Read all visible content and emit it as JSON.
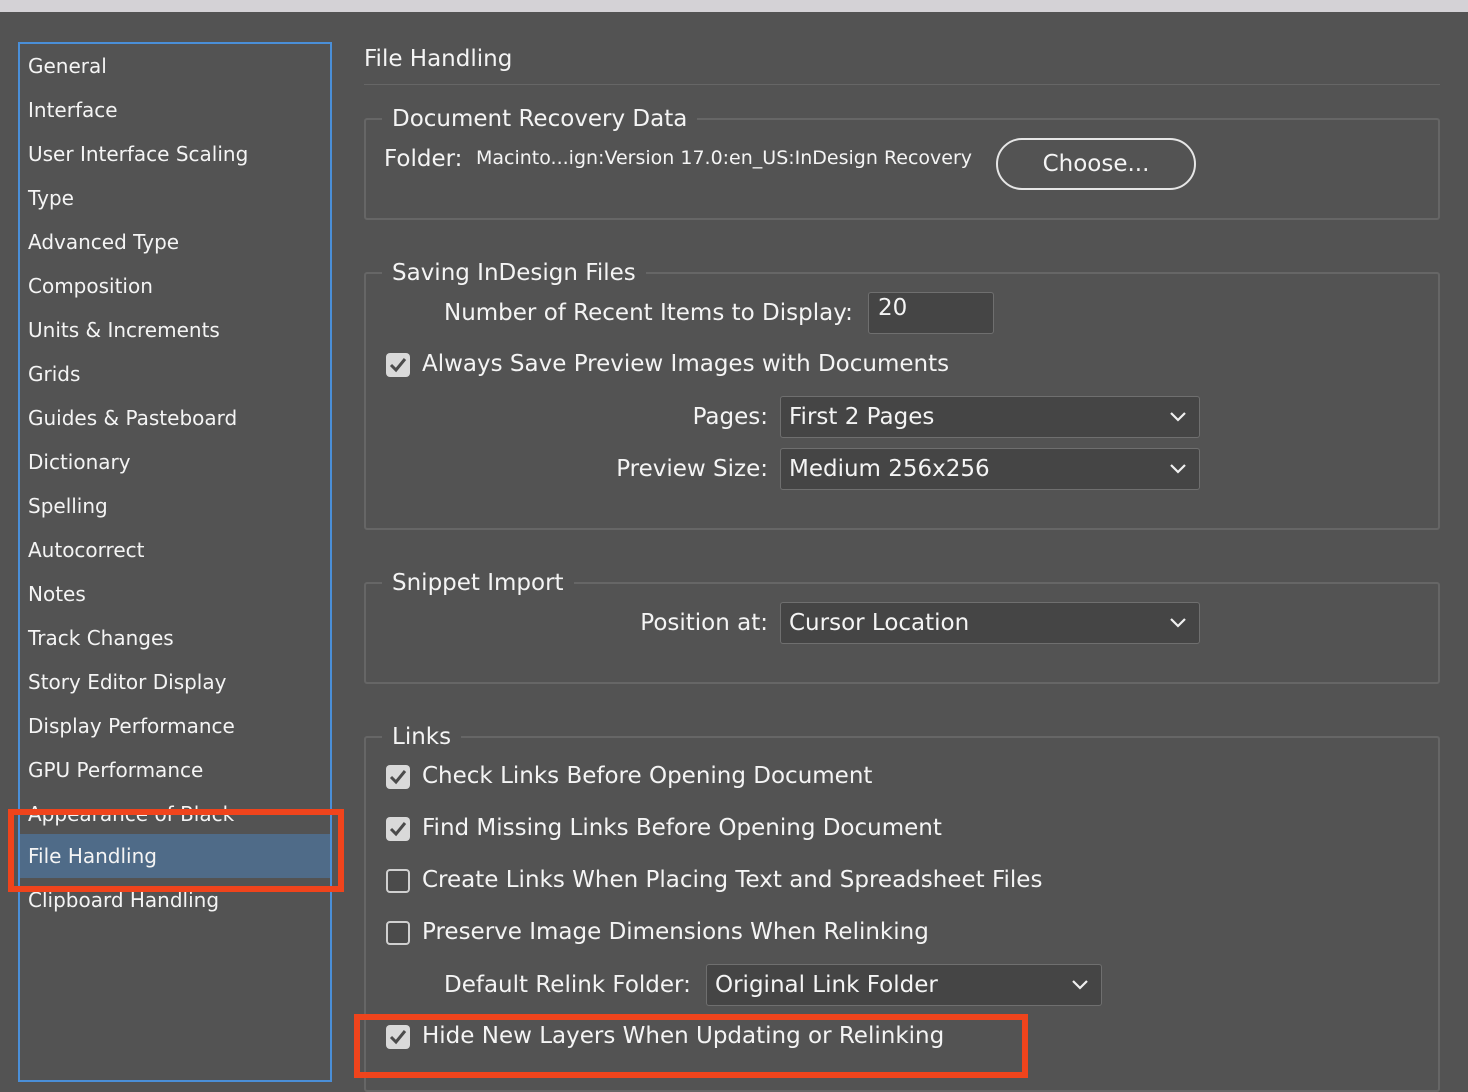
{
  "sidebar": {
    "items": [
      {
        "label": "General"
      },
      {
        "label": "Interface"
      },
      {
        "label": "User Interface Scaling"
      },
      {
        "label": "Type"
      },
      {
        "label": "Advanced Type"
      },
      {
        "label": "Composition"
      },
      {
        "label": "Units & Increments"
      },
      {
        "label": "Grids"
      },
      {
        "label": "Guides & Pasteboard"
      },
      {
        "label": "Dictionary"
      },
      {
        "label": "Spelling"
      },
      {
        "label": "Autocorrect"
      },
      {
        "label": "Notes"
      },
      {
        "label": "Track Changes"
      },
      {
        "label": "Story Editor Display"
      },
      {
        "label": "Display Performance"
      },
      {
        "label": "GPU Performance"
      },
      {
        "label": "Appearance of Black"
      },
      {
        "label": "File Handling",
        "selected": true
      },
      {
        "label": "Clipboard Handling"
      }
    ]
  },
  "main": {
    "title": "File Handling",
    "recovery": {
      "legend": "Document Recovery Data",
      "folder_label": "Folder:",
      "folder_path": "Macinto...ign:Version 17.0:en_US:InDesign Recovery",
      "choose_button": "Choose..."
    },
    "saving": {
      "legend": "Saving InDesign Files",
      "recent_label": "Number of Recent Items to Display:",
      "recent_value": "20",
      "preview_checkbox": {
        "label": "Always Save Preview Images with Documents",
        "checked": true
      },
      "pages_label": "Pages:",
      "pages_value": "First 2 Pages",
      "preview_size_label": "Preview Size:",
      "preview_size_value": "Medium 256x256"
    },
    "snippet": {
      "legend": "Snippet Import",
      "position_label": "Position at:",
      "position_value": "Cursor Location"
    },
    "links": {
      "legend": "Links",
      "check_links": {
        "label": "Check Links Before Opening Document",
        "checked": true
      },
      "find_missing": {
        "label": "Find Missing Links Before Opening Document",
        "checked": true
      },
      "create_links": {
        "label": "Create Links When Placing Text and Spreadsheet Files",
        "checked": false
      },
      "preserve_dims": {
        "label": "Preserve Image Dimensions When Relinking",
        "checked": false
      },
      "relink_label": "Default Relink Folder:",
      "relink_value": "Original Link Folder",
      "hide_layers": {
        "label": "Hide New Layers When Updating or Relinking",
        "checked": true
      }
    }
  },
  "colors": {
    "background": "#535353",
    "selection": "#4f6b88",
    "focus_border": "#4a8fd8",
    "annotation_highlight": "#f0441c"
  },
  "icons": {
    "checkbox_checked": "checkmark-icon",
    "dropdown": "chevron-down-icon"
  }
}
